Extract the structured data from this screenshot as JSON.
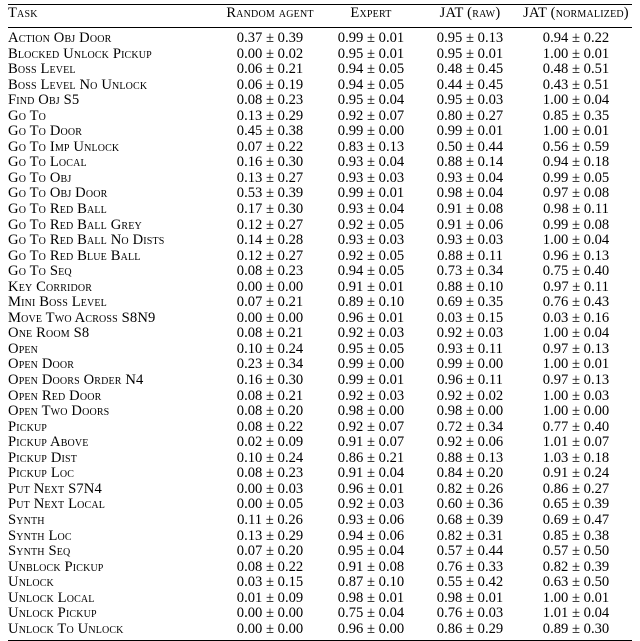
{
  "table": {
    "columns": [
      {
        "key": "task",
        "label": "Task",
        "align": "left"
      },
      {
        "key": "random_agent",
        "label": "Random agent",
        "align": "center"
      },
      {
        "key": "expert",
        "label": "Expert",
        "align": "center"
      },
      {
        "key": "jat_raw",
        "label": "JAT (raw)",
        "align": "center"
      },
      {
        "key": "jat_normalized",
        "label": "JAT (normalized)",
        "align": "center"
      }
    ],
    "rows": [
      {
        "task": "Action Obj Door",
        "random_agent": "0.37 ± 0.39",
        "expert": "0.99 ± 0.01",
        "jat_raw": "0.95 ± 0.13",
        "jat_normalized": "0.94 ± 0.22"
      },
      {
        "task": "Blocked Unlock Pickup",
        "random_agent": "0.00 ± 0.02",
        "expert": "0.95 ± 0.01",
        "jat_raw": "0.95 ± 0.01",
        "jat_normalized": "1.00 ± 0.01"
      },
      {
        "task": "Boss Level",
        "random_agent": "0.06 ± 0.21",
        "expert": "0.94 ± 0.05",
        "jat_raw": "0.48 ± 0.45",
        "jat_normalized": "0.48 ± 0.51"
      },
      {
        "task": "Boss Level No Unlock",
        "random_agent": "0.06 ± 0.19",
        "expert": "0.94 ± 0.05",
        "jat_raw": "0.44 ± 0.45",
        "jat_normalized": "0.43 ± 0.51"
      },
      {
        "task": "Find Obj S5",
        "random_agent": "0.08 ± 0.23",
        "expert": "0.95 ± 0.04",
        "jat_raw": "0.95 ± 0.03",
        "jat_normalized": "1.00 ± 0.04"
      },
      {
        "task": "Go To",
        "random_agent": "0.13 ± 0.29",
        "expert": "0.92 ± 0.07",
        "jat_raw": "0.80 ± 0.27",
        "jat_normalized": "0.85 ± 0.35"
      },
      {
        "task": "Go To Door",
        "random_agent": "0.45 ± 0.38",
        "expert": "0.99 ± 0.00",
        "jat_raw": "0.99 ± 0.01",
        "jat_normalized": "1.00 ± 0.01"
      },
      {
        "task": "Go To Imp Unlock",
        "random_agent": "0.07 ± 0.22",
        "expert": "0.83 ± 0.13",
        "jat_raw": "0.50 ± 0.44",
        "jat_normalized": "0.56 ± 0.59"
      },
      {
        "task": "Go To Local",
        "random_agent": "0.16 ± 0.30",
        "expert": "0.93 ± 0.04",
        "jat_raw": "0.88 ± 0.14",
        "jat_normalized": "0.94 ± 0.18"
      },
      {
        "task": "Go To Obj",
        "random_agent": "0.13 ± 0.27",
        "expert": "0.93 ± 0.03",
        "jat_raw": "0.93 ± 0.04",
        "jat_normalized": "0.99 ± 0.05"
      },
      {
        "task": "Go To Obj Door",
        "random_agent": "0.53 ± 0.39",
        "expert": "0.99 ± 0.01",
        "jat_raw": "0.98 ± 0.04",
        "jat_normalized": "0.97 ± 0.08"
      },
      {
        "task": "Go To Red Ball",
        "random_agent": "0.17 ± 0.30",
        "expert": "0.93 ± 0.04",
        "jat_raw": "0.91 ± 0.08",
        "jat_normalized": "0.98 ± 0.11"
      },
      {
        "task": "Go To Red Ball Grey",
        "random_agent": "0.12 ± 0.27",
        "expert": "0.92 ± 0.05",
        "jat_raw": "0.91 ± 0.06",
        "jat_normalized": "0.99 ± 0.08"
      },
      {
        "task": "Go To Red Ball No Dists",
        "random_agent": "0.14 ± 0.28",
        "expert": "0.93 ± 0.03",
        "jat_raw": "0.93 ± 0.03",
        "jat_normalized": "1.00 ± 0.04"
      },
      {
        "task": "Go To Red Blue Ball",
        "random_agent": "0.12 ± 0.27",
        "expert": "0.92 ± 0.05",
        "jat_raw": "0.88 ± 0.11",
        "jat_normalized": "0.96 ± 0.13"
      },
      {
        "task": "Go To Seq",
        "random_agent": "0.08 ± 0.23",
        "expert": "0.94 ± 0.05",
        "jat_raw": "0.73 ± 0.34",
        "jat_normalized": "0.75 ± 0.40"
      },
      {
        "task": "Key Corridor",
        "random_agent": "0.00 ± 0.00",
        "expert": "0.91 ± 0.01",
        "jat_raw": "0.88 ± 0.10",
        "jat_normalized": "0.97 ± 0.11"
      },
      {
        "task": "Mini Boss Level",
        "random_agent": "0.07 ± 0.21",
        "expert": "0.89 ± 0.10",
        "jat_raw": "0.69 ± 0.35",
        "jat_normalized": "0.76 ± 0.43"
      },
      {
        "task": "Move Two Across S8N9",
        "random_agent": "0.00 ± 0.00",
        "expert": "0.96 ± 0.01",
        "jat_raw": "0.03 ± 0.15",
        "jat_normalized": "0.03 ± 0.16"
      },
      {
        "task": "One Room S8",
        "random_agent": "0.08 ± 0.21",
        "expert": "0.92 ± 0.03",
        "jat_raw": "0.92 ± 0.03",
        "jat_normalized": "1.00 ± 0.04"
      },
      {
        "task": "Open",
        "random_agent": "0.10 ± 0.24",
        "expert": "0.95 ± 0.05",
        "jat_raw": "0.93 ± 0.11",
        "jat_normalized": "0.97 ± 0.13"
      },
      {
        "task": "Open Door",
        "random_agent": "0.23 ± 0.34",
        "expert": "0.99 ± 0.00",
        "jat_raw": "0.99 ± 0.00",
        "jat_normalized": "1.00 ± 0.01"
      },
      {
        "task": "Open Doors Order N4",
        "random_agent": "0.16 ± 0.30",
        "expert": "0.99 ± 0.01",
        "jat_raw": "0.96 ± 0.11",
        "jat_normalized": "0.97 ± 0.13"
      },
      {
        "task": "Open Red Door",
        "random_agent": "0.08 ± 0.21",
        "expert": "0.92 ± 0.03",
        "jat_raw": "0.92 ± 0.02",
        "jat_normalized": "1.00 ± 0.03"
      },
      {
        "task": "Open Two Doors",
        "random_agent": "0.08 ± 0.20",
        "expert": "0.98 ± 0.00",
        "jat_raw": "0.98 ± 0.00",
        "jat_normalized": "1.00 ± 0.00"
      },
      {
        "task": "Pickup",
        "random_agent": "0.08 ± 0.22",
        "expert": "0.92 ± 0.07",
        "jat_raw": "0.72 ± 0.34",
        "jat_normalized": "0.77 ± 0.40"
      },
      {
        "task": "Pickup Above",
        "random_agent": "0.02 ± 0.09",
        "expert": "0.91 ± 0.07",
        "jat_raw": "0.92 ± 0.06",
        "jat_normalized": "1.01 ± 0.07"
      },
      {
        "task": "Pickup Dist",
        "random_agent": "0.10 ± 0.24",
        "expert": "0.86 ± 0.21",
        "jat_raw": "0.88 ± 0.13",
        "jat_normalized": "1.03 ± 0.18"
      },
      {
        "task": "Pickup Loc",
        "random_agent": "0.08 ± 0.23",
        "expert": "0.91 ± 0.04",
        "jat_raw": "0.84 ± 0.20",
        "jat_normalized": "0.91 ± 0.24"
      },
      {
        "task": "Put Next S7N4",
        "random_agent": "0.00 ± 0.03",
        "expert": "0.96 ± 0.01",
        "jat_raw": "0.82 ± 0.26",
        "jat_normalized": "0.86 ± 0.27"
      },
      {
        "task": "Put Next Local",
        "random_agent": "0.00 ± 0.05",
        "expert": "0.92 ± 0.03",
        "jat_raw": "0.60 ± 0.36",
        "jat_normalized": "0.65 ± 0.39"
      },
      {
        "task": "Synth",
        "random_agent": "0.11 ± 0.26",
        "expert": "0.93 ± 0.06",
        "jat_raw": "0.68 ± 0.39",
        "jat_normalized": "0.69 ± 0.47"
      },
      {
        "task": "Synth Loc",
        "random_agent": "0.13 ± 0.29",
        "expert": "0.94 ± 0.06",
        "jat_raw": "0.82 ± 0.31",
        "jat_normalized": "0.85 ± 0.38"
      },
      {
        "task": "Synth Seq",
        "random_agent": "0.07 ± 0.20",
        "expert": "0.95 ± 0.04",
        "jat_raw": "0.57 ± 0.44",
        "jat_normalized": "0.57 ± 0.50"
      },
      {
        "task": "Unblock Pickup",
        "random_agent": "0.08 ± 0.22",
        "expert": "0.91 ± 0.08",
        "jat_raw": "0.76 ± 0.33",
        "jat_normalized": "0.82 ± 0.39"
      },
      {
        "task": "Unlock",
        "random_agent": "0.03 ± 0.15",
        "expert": "0.87 ± 0.10",
        "jat_raw": "0.55 ± 0.42",
        "jat_normalized": "0.63 ± 0.50"
      },
      {
        "task": "Unlock Local",
        "random_agent": "0.01 ± 0.09",
        "expert": "0.98 ± 0.01",
        "jat_raw": "0.98 ± 0.01",
        "jat_normalized": "1.00 ± 0.01"
      },
      {
        "task": "Unlock Pickup",
        "random_agent": "0.00 ± 0.00",
        "expert": "0.75 ± 0.04",
        "jat_raw": "0.76 ± 0.03",
        "jat_normalized": "1.01 ± 0.04"
      },
      {
        "task": "Unlock To Unlock",
        "random_agent": "0.00 ± 0.00",
        "expert": "0.96 ± 0.00",
        "jat_raw": "0.86 ± 0.29",
        "jat_normalized": "0.89 ± 0.30"
      }
    ]
  }
}
